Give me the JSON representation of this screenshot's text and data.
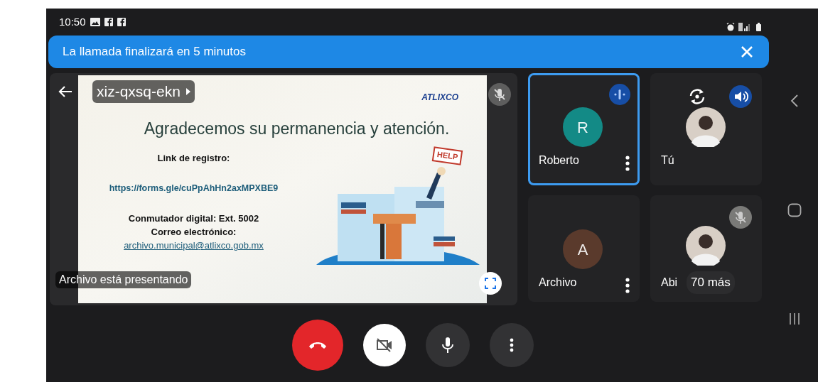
{
  "status_bar": {
    "time": "10:50"
  },
  "banner": {
    "message": "La llamada finalizará en 5 minutos"
  },
  "meeting": {
    "code": "xiz-qxsq-ekn",
    "presenter_caption": "Archivo está presentando",
    "muted": true
  },
  "slide": {
    "logo": "ATLIXCO",
    "title": "Agradecemos su permanencia y atención.",
    "sign": "HELP",
    "blocks": [
      [
        {
          "kind": "label",
          "text": "Link de registro:"
        }
      ],
      [
        {
          "kind": "url",
          "text": "https://forms.gle/cuPpAhHn2axMPXBE9"
        }
      ],
      [
        {
          "kind": "label",
          "text": "Conmutador digital: Ext. 5002"
        },
        {
          "kind": "label",
          "text": "Correo electrónico:"
        },
        {
          "kind": "email",
          "text": "archivo.municipal@atlixco.gob.mx"
        }
      ]
    ]
  },
  "participants": [
    {
      "kind": "participant",
      "name": "Roberto",
      "initial": "R",
      "color": "#138a86",
      "selected": true,
      "speaking": true,
      "muted": false,
      "menu": true
    },
    {
      "kind": "self",
      "name": "Tú",
      "selected": false,
      "speaking": false,
      "muted": false,
      "menu": false
    },
    {
      "kind": "participant",
      "name": "Archivo",
      "initial": "A",
      "color": "#5a3a2c",
      "selected": false,
      "speaking": false,
      "muted": false,
      "menu": true
    },
    {
      "kind": "overflow",
      "name": "Abi",
      "more": "70 más",
      "selected": false,
      "speaking": false,
      "muted": true,
      "menu": false
    }
  ],
  "controls": [
    {
      "kind": "end_call"
    },
    {
      "kind": "camera",
      "on": false
    },
    {
      "kind": "mic",
      "on": true
    },
    {
      "kind": "more"
    }
  ]
}
